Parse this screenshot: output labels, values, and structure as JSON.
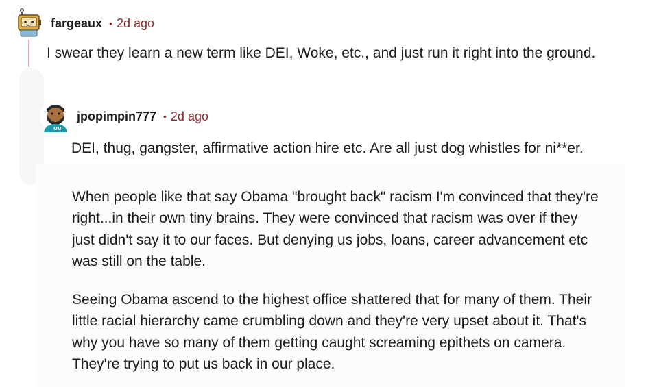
{
  "comments": [
    {
      "username": "fargeaux",
      "separator": "•",
      "time": "2d ago",
      "avatar_icon": "robot-avatar-icon",
      "body": "I swear they learn a new term like DEI, Woke, etc., and just run it right into the ground."
    },
    {
      "username": "jpopimpin777",
      "separator": "•",
      "time": "2d ago",
      "avatar_icon": "bearded-man-avatar-icon",
      "paragraphs": [
        "DEI, thug, gangster, affirmative action hire etc. Are all just dog whistles for ni**er.",
        "When people like that say Obama \"brought back\" racism I'm convinced that they're right...in their own tiny brains. They were convinced that racism was over if they just didn't say it to our faces. But denying us jobs, loans, career advancement etc was still on the table.",
        "Seeing Obama ascend to the highest office shattered that for many of them. Their little racial hierarchy came crumbling down and they're very upset about it. That's why you have so many of them getting caught screaming epithets on camera. They're trying to put us back in our place."
      ]
    }
  ],
  "colors": {
    "timestamp": "#8b2b2b",
    "thread_line": "#e6b3b3",
    "text": "#1c1c1c"
  }
}
